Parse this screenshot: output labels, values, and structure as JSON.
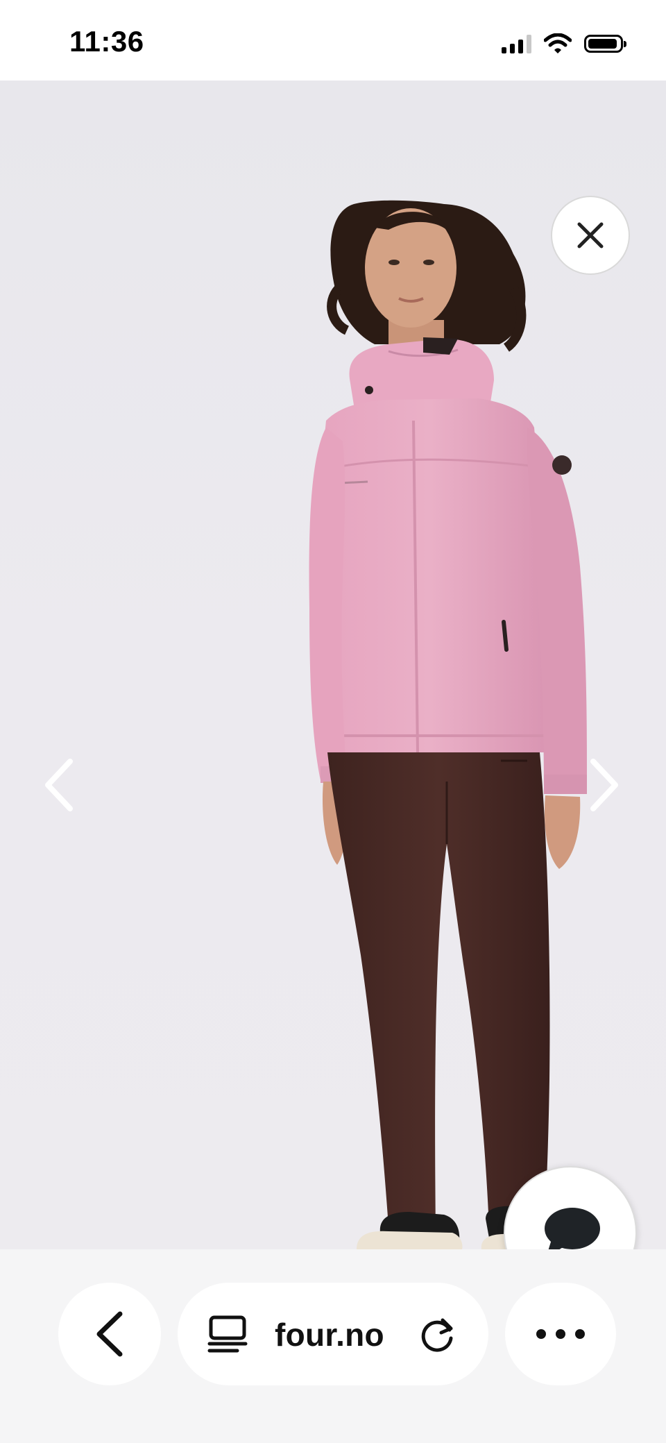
{
  "status_bar": {
    "time": "11:36",
    "icons": [
      "signal-icon",
      "wifi-icon",
      "battery-icon"
    ]
  },
  "product_gallery": {
    "controls": {
      "close": "close-icon",
      "previous": "chevron-left-icon",
      "next": "chevron-right-icon",
      "chat": "chat-bubble-icon"
    },
    "colors": {
      "background": "#ebe9ee",
      "jacket": "#e8a8c2",
      "trousers": "#4a2a26",
      "shoes": "#1c1c1c",
      "soles": "#ece3d4"
    }
  },
  "browser": {
    "url": "four.no",
    "buttons": {
      "back": "chevron-left-icon",
      "reader": "reader-mode-icon",
      "reload": "reload-icon",
      "more": "more-dots-icon"
    },
    "colors": {
      "bar_background": "#f5f5f6",
      "pill_background": "#ffffff"
    }
  }
}
